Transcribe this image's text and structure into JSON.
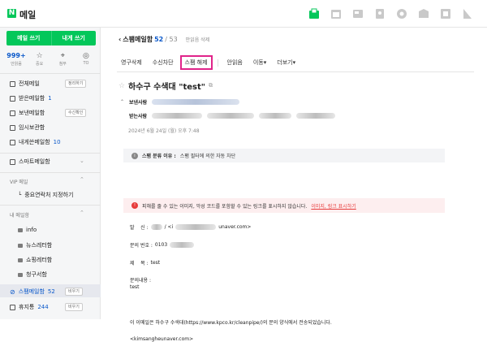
{
  "app": {
    "logo_letter": "N",
    "title": "메일"
  },
  "sidebar": {
    "write_mail": "메일 쓰기",
    "write_to_me": "내게 쓰기",
    "quick": [
      {
        "value": "999+",
        "label": "안읽음"
      },
      {
        "icon": "star-icon",
        "label": "중요"
      },
      {
        "icon": "clip-icon",
        "label": "첨부"
      },
      {
        "icon": "to-icon",
        "label": "TO"
      }
    ],
    "items": [
      {
        "label": "전체메일",
        "button": "정리하기"
      },
      {
        "label": "받은메일함",
        "count": "1"
      },
      {
        "label": "보낸메일함",
        "button": "수신확인"
      },
      {
        "label": "임시보관함"
      },
      {
        "label": "내게쓴메일함",
        "count": "10"
      },
      {
        "label": "스마트메일함"
      }
    ],
    "vip_header": "VIP 메일",
    "vip_item": "중요연락처 지정하기",
    "my_header": "내 메일함",
    "folders": [
      "info",
      "뉴스레터함",
      "쇼핑레터함",
      "청구서함"
    ],
    "spam": {
      "label": "스팸메일함",
      "count": "52",
      "button": "비우기"
    },
    "trash": {
      "label": "휴지통",
      "count": "244",
      "button": "비우기"
    }
  },
  "header": {
    "title": "스팸메일함",
    "current": "52",
    "total": "/ 53",
    "unread_delete": "안읽음 삭제"
  },
  "toolbar": {
    "delete_forever": "영구삭제",
    "block": "수신차단",
    "unspam": "스팸 해제",
    "unread": "안읽음",
    "move": "이동",
    "more": "더보기"
  },
  "mail": {
    "subject": "하수구 수색대 \"test\"",
    "sender_label": "보낸사람",
    "recipient_label": "받는사람",
    "date": "2024년 6월 24일 (월) 오후 7:48",
    "spam_reason_label": "스팸 분류 이유 :",
    "spam_reason": "스팸 필터에 의한 자동 차단",
    "warning": "피해를 줄 수 있는 이미지, 악성 코드를 포함할 수 있는 링크를 표시하지 않습니다.",
    "warning_link": "이미지, 링크 표시하기",
    "from_label": "발    신 :",
    "from_value": "/ <i",
    "from_domain": "unaver.com>",
    "phone_label": "문의 번호 :",
    "phone_value": "0103",
    "title_label": "제    목 :",
    "title_value": "test",
    "content_label": "문의내용 :",
    "content_value": "test",
    "footer_text": "이 이메일은 하수구 수색대(https://www.kpco.kr/cleanpipe/)의 문의 양식에서 전송되었습니다.",
    "footer_email": "<kimsangheunaver.com>"
  }
}
